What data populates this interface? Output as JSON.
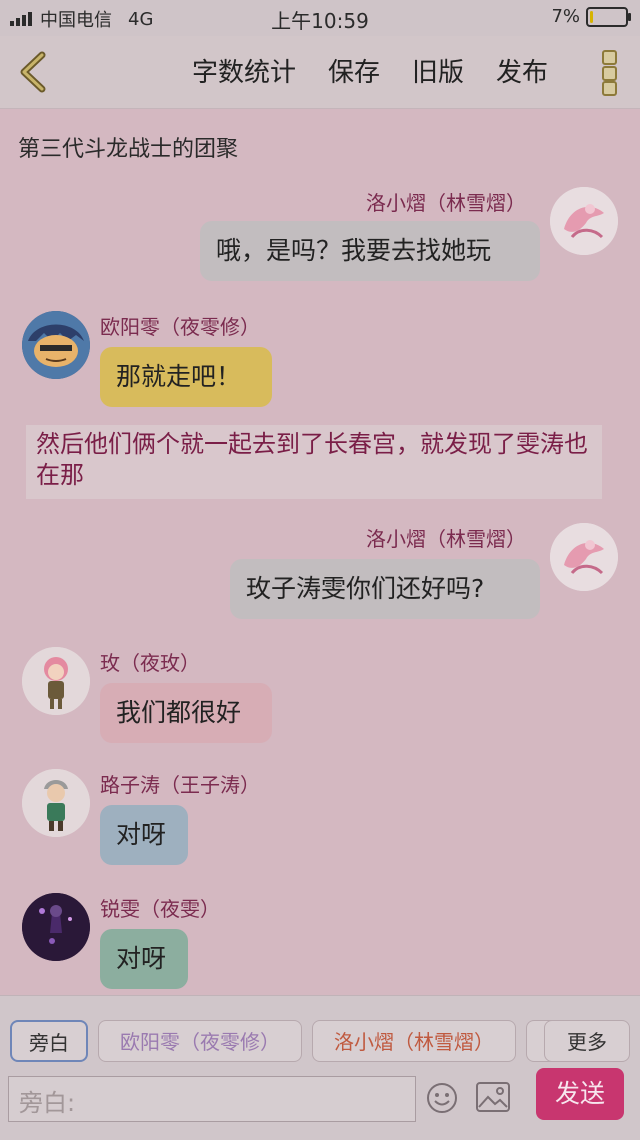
{
  "status_bar": {
    "carrier": "中国电信",
    "network": "4G",
    "time": "上午10:59",
    "battery": "7%",
    "battery_level": 0.07
  },
  "toolbar": {
    "back_icon": "chevron-left-icon",
    "word_count": "字数统计",
    "save": "保存",
    "old_version": "旧版",
    "publish": "发布",
    "more_icon": "vertical-dots-icon"
  },
  "story": {
    "title": "第三代斗龙战士的团聚"
  },
  "messages": [
    {
      "name": "洛小熠（林雪熠）",
      "text": "哦，是吗？我要去找她玩"
    },
    {
      "name": "欧阳零（夜零修）",
      "text": "那就走吧！"
    },
    {
      "name": "洛小熠（林雪熠）",
      "text": "玫子涛雯你们还好吗?"
    },
    {
      "name": "玫（夜玫）",
      "text": "我们都很好"
    },
    {
      "name": "路子涛（王子涛）",
      "text": "对呀"
    },
    {
      "name": "锐雯（夜雯）",
      "text": "对呀"
    }
  ],
  "narration": {
    "text": "然后他们俩个就一起去到了长春宫，就发现了雯涛也在那"
  },
  "colors": {
    "bubble_self": "#c2bdbf",
    "bubble_yellow": "#d8bb5c",
    "bubble_pink": "#d7adb5",
    "bubble_blue": "#9eb0bf",
    "bubble_teal": "#8cae9f",
    "send": "#c8366f"
  },
  "bottom": {
    "roles": [
      "旁白",
      "欧阳零（夜零修）",
      "洛小熠（林雪熠）"
    ],
    "more": "更多",
    "input_placeholder": "旁白:",
    "send": "发送"
  }
}
